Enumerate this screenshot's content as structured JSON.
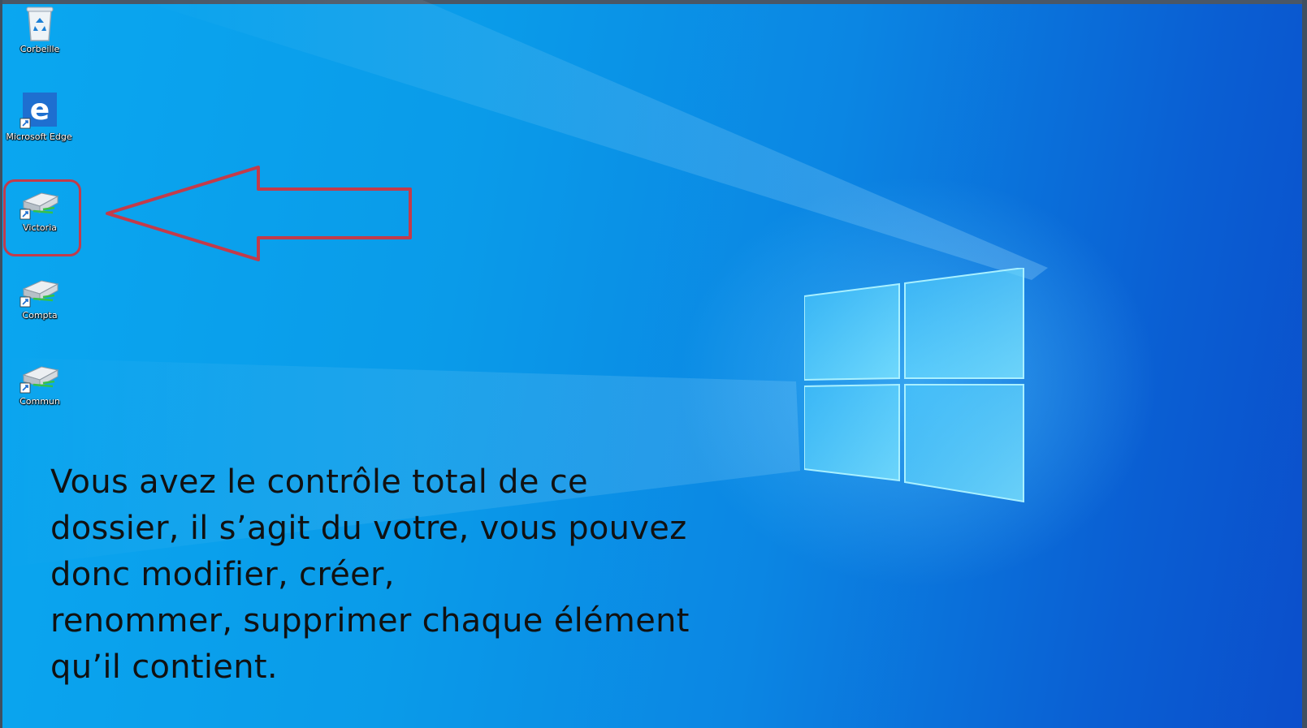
{
  "desktop": {
    "icons": [
      {
        "label": "Corbeille",
        "icon": "recycle-bin-icon"
      },
      {
        "label": "Microsoft Edge",
        "icon": "edge-icon"
      },
      {
        "label": "Victoria",
        "icon": "network-drive-icon"
      },
      {
        "label": "Compta",
        "icon": "network-drive-icon"
      },
      {
        "label": "Commun",
        "icon": "network-drive-icon"
      }
    ],
    "highlighted_icon": "Victoria",
    "caption_lines": [
      "Vous avez le contrôle total de ce",
      "dossier, il s’agit du votre, vous pouvez",
      "donc modifier, créer,",
      "renommer, supprimer chaque élément",
      "qu’il contient."
    ]
  },
  "colors": {
    "highlight": "#c33b4a",
    "caption_text": "#111111",
    "wallpaper_blue": "#0a9be9"
  }
}
